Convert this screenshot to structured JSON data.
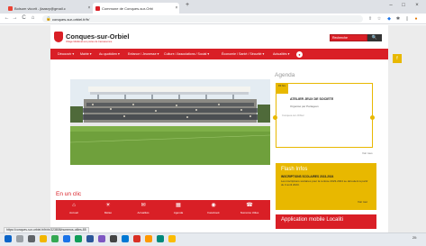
{
  "browser": {
    "tabs": [
      {
        "label": "Bolsum vlcorit - jlaasry@gmail.c",
        "active": false
      },
      {
        "label": "Commune de Conques-sur-Orbi",
        "active": true
      }
    ],
    "new_tab": "+",
    "window_controls": {
      "minimize": "–",
      "maximize": "□",
      "close": "×"
    },
    "url": "conques-sur-orbiel.fr/fr/",
    "nav": {
      "back": "←",
      "forward": "→",
      "reload": "C",
      "home": "⌂"
    },
    "status_url": "https://conques-sur-orbiel.fr/fr/rb/323808/numeros-utiles-85"
  },
  "site": {
    "title": "Conques-sur-Orbiel",
    "subtitle": "Village Médiéval aux portes de Carcassonne",
    "search_placeholder": "Recherche",
    "search_button": "🔍",
    "menu": [
      "Découvrir ▾",
      "Mairie ▾",
      "Au quotidien ▾",
      "Enfance / Jeunesse ▾",
      "Culture / Associations / Social ▾",
      "Économie / Santé / Sécurité ▾",
      "Actualités ▾"
    ],
    "menu_badge": "●",
    "side_button": "f"
  },
  "agenda": {
    "title": "Agenda",
    "date_label": "03 fév",
    "event_title": "ATELIER JEUX DE SOCIETE",
    "organizer": "Organisé par Partageux",
    "location": "Conques-sur-Orbiel",
    "more": "Voir tous"
  },
  "flash": {
    "title": "Flash Infos",
    "headline": "INSCRIPTIONS SCOLAIRES 2023-2024",
    "body": "Les inscriptions scolaires pour la rentrée 2023-2024 se déroulent à partir du 3 avril 2023.",
    "more": "Voir tout"
  },
  "appli": {
    "title": "Application mobile Localiti"
  },
  "clic": {
    "title": "En un clic",
    "items": [
      {
        "icon": "⌂",
        "label": "Accueil"
      },
      {
        "icon": "☀",
        "label": "Météo"
      },
      {
        "icon": "✉",
        "label": "Actualités"
      },
      {
        "icon": "▦",
        "label": "Agenda"
      },
      {
        "icon": "◉",
        "label": "Facebook"
      },
      {
        "icon": "☎",
        "label": "Numéros Utiles"
      }
    ]
  },
  "taskbar": {
    "clock": "20:"
  },
  "colors": {
    "brand_red": "#d91f26",
    "accent_yellow": "#e8b800"
  }
}
